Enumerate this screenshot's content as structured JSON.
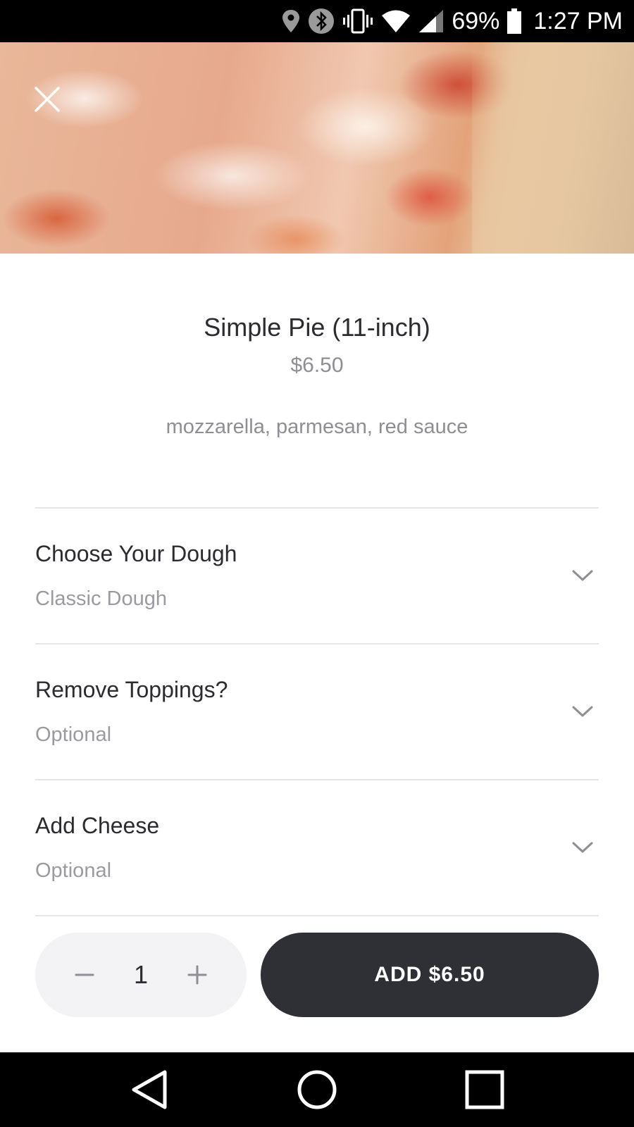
{
  "status_bar": {
    "icons": [
      "location-icon",
      "bluetooth-icon",
      "vibrate-icon",
      "wifi-icon",
      "signal-icon",
      "battery-icon"
    ],
    "battery_percent": "69%",
    "time": "1:27 PM"
  },
  "hero": {
    "close_icon": "close-icon"
  },
  "item": {
    "title": "Simple Pie (11-inch)",
    "price": "$6.50",
    "description": "mozzarella, parmesan, red sauce"
  },
  "options": [
    {
      "title": "Choose Your Dough",
      "subtitle": "Classic Dough",
      "icon": "chevron-down-icon"
    },
    {
      "title": "Remove Toppings?",
      "subtitle": "Optional",
      "icon": "chevron-down-icon"
    },
    {
      "title": "Add Cheese",
      "subtitle": "Optional",
      "icon": "chevron-down-icon"
    }
  ],
  "quantity": {
    "value": "1",
    "decrement_icon": "minus-icon",
    "increment_icon": "plus-icon"
  },
  "add_button": {
    "label": "ADD $6.50"
  },
  "nav_bar": {
    "icons": [
      "back-icon",
      "home-icon",
      "recents-icon"
    ]
  },
  "colors": {
    "primary_text": "#2b2b30",
    "secondary_text": "#8e8e95",
    "button_dark": "#2f3036",
    "pill_bg": "#f3f3f5",
    "divider": "#e6e6e8"
  }
}
